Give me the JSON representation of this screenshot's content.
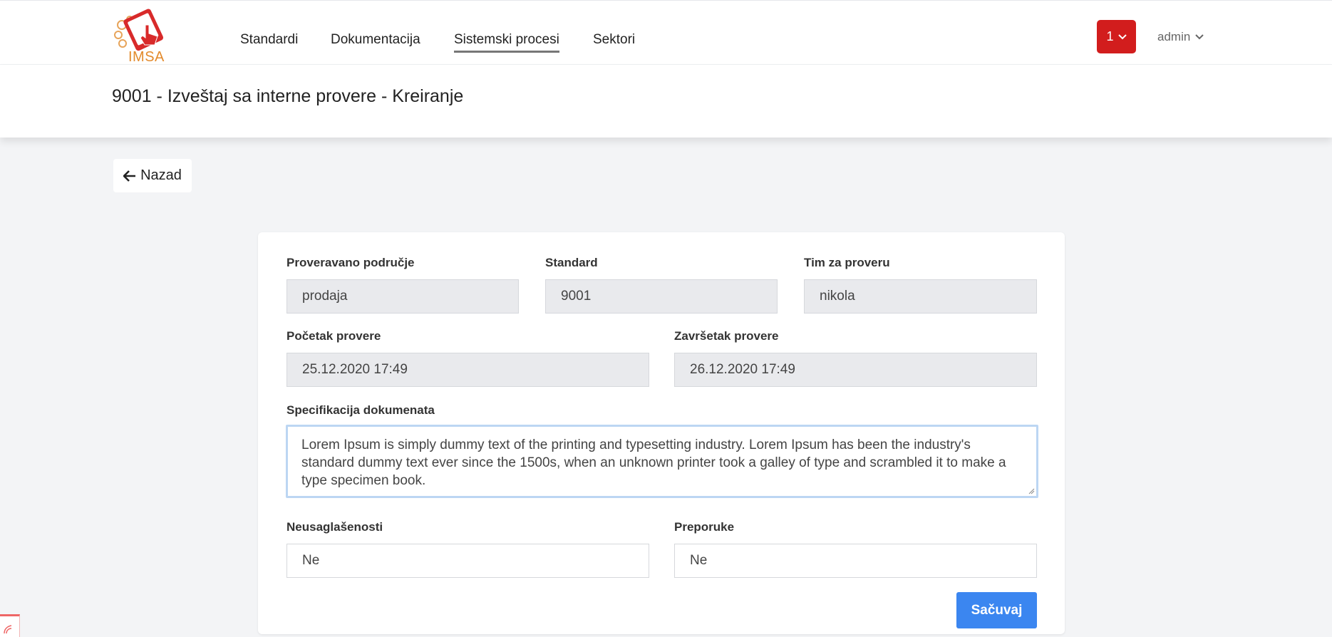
{
  "header": {
    "logo_text": "IMSA",
    "nav": [
      {
        "label": "Standardi"
      },
      {
        "label": "Dokumentacija"
      },
      {
        "label": "Sistemski procesi"
      },
      {
        "label": "Sektori"
      }
    ],
    "notification_count": "1",
    "user_name": "admin"
  },
  "page": {
    "title": "9001 - Izveštaj sa interne provere - Kreiranje",
    "back_label": "Nazad"
  },
  "form": {
    "proveravano_podrucje": {
      "label": "Proveravano područje",
      "value": "prodaja"
    },
    "standard": {
      "label": "Standard",
      "value": "9001"
    },
    "tim": {
      "label": "Tim za proveru",
      "value": "nikola"
    },
    "pocetak": {
      "label": "Početak provere",
      "value": "25.12.2020 17:49"
    },
    "zavrsetak": {
      "label": "Završetak provere",
      "value": "26.12.2020 17:49"
    },
    "specifikacija": {
      "label": "Specifikacija dokumenata",
      "value": "Lorem Ipsum is simply dummy text of the printing and typesetting industry. Lorem Ipsum has been the industry's standard dummy text ever since the 1500s, when an unknown printer took a galley of type and scrambled it to make a type specimen book."
    },
    "neusaglasenosti": {
      "label": "Neusaglašenosti",
      "value": "Ne"
    },
    "preporuke": {
      "label": "Preporuke",
      "value": "Ne"
    },
    "save_label": "Sačuvaj"
  },
  "colors": {
    "accent": "#3b86f0",
    "notification": "#d21d1d",
    "logo": "#d82a2a"
  }
}
